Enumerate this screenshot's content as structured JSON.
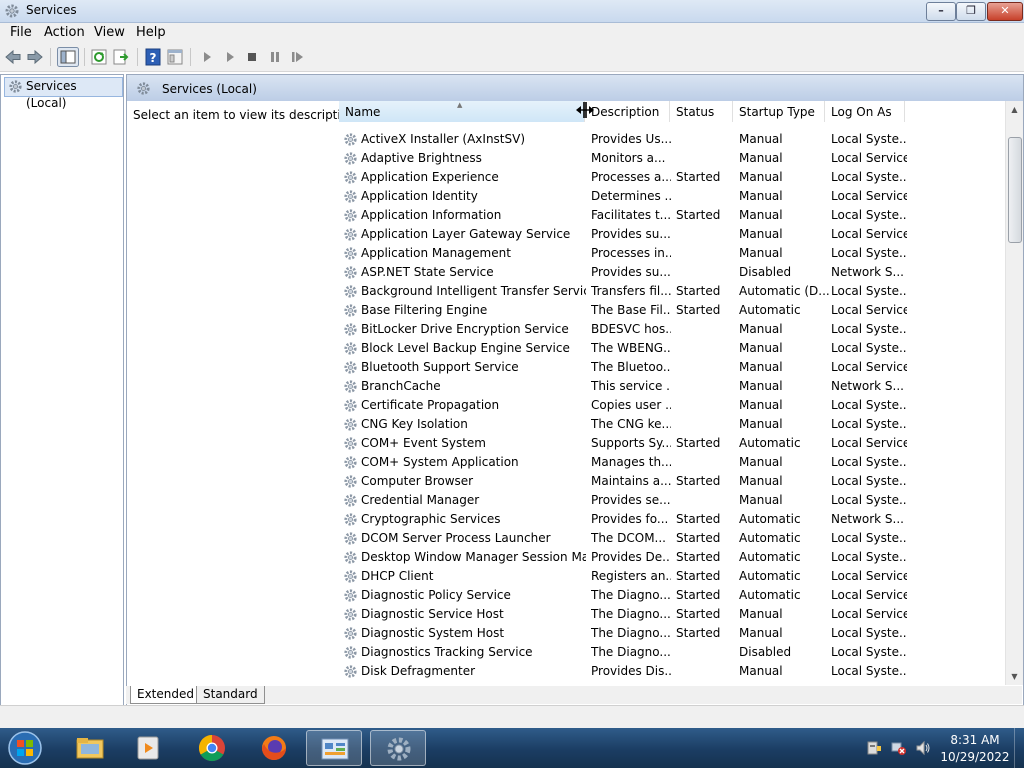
{
  "window": {
    "title": "Services"
  },
  "menu": [
    "File",
    "Action",
    "View",
    "Help"
  ],
  "tree": {
    "root": "Services (Local)"
  },
  "pane": {
    "title": "Services (Local)",
    "description_prompt": "Select an item to view its description."
  },
  "columns": [
    "Name",
    "Description",
    "Status",
    "Startup Type",
    "Log On As"
  ],
  "services": [
    [
      "ActiveX Installer (AxInstSV)",
      "Provides Us...",
      "",
      "Manual",
      "Local Syste..."
    ],
    [
      "Adaptive Brightness",
      "Monitors a...",
      "",
      "Manual",
      "Local Service"
    ],
    [
      "Application Experience",
      "Processes a...",
      "Started",
      "Manual",
      "Local Syste..."
    ],
    [
      "Application Identity",
      "Determines ...",
      "",
      "Manual",
      "Local Service"
    ],
    [
      "Application Information",
      "Facilitates t...",
      "Started",
      "Manual",
      "Local Syste..."
    ],
    [
      "Application Layer Gateway Service",
      "Provides su...",
      "",
      "Manual",
      "Local Service"
    ],
    [
      "Application Management",
      "Processes in...",
      "",
      "Manual",
      "Local Syste..."
    ],
    [
      "ASP.NET State Service",
      "Provides su...",
      "",
      "Disabled",
      "Network S..."
    ],
    [
      "Background Intelligent Transfer Service",
      "Transfers fil...",
      "Started",
      "Automatic (D...",
      "Local Syste..."
    ],
    [
      "Base Filtering Engine",
      "The Base Fil...",
      "Started",
      "Automatic",
      "Local Service"
    ],
    [
      "BitLocker Drive Encryption Service",
      "BDESVC hos...",
      "",
      "Manual",
      "Local Syste..."
    ],
    [
      "Block Level Backup Engine Service",
      "The WBENG...",
      "",
      "Manual",
      "Local Syste..."
    ],
    [
      "Bluetooth Support Service",
      "The Bluetoo...",
      "",
      "Manual",
      "Local Service"
    ],
    [
      "BranchCache",
      "This service ...",
      "",
      "Manual",
      "Network S..."
    ],
    [
      "Certificate Propagation",
      "Copies user ...",
      "",
      "Manual",
      "Local Syste..."
    ],
    [
      "CNG Key Isolation",
      "The CNG ke...",
      "",
      "Manual",
      "Local Syste..."
    ],
    [
      "COM+ Event System",
      "Supports Sy...",
      "Started",
      "Automatic",
      "Local Service"
    ],
    [
      "COM+ System Application",
      "Manages th...",
      "",
      "Manual",
      "Local Syste..."
    ],
    [
      "Computer Browser",
      "Maintains a...",
      "Started",
      "Manual",
      "Local Syste..."
    ],
    [
      "Credential Manager",
      "Provides se...",
      "",
      "Manual",
      "Local Syste..."
    ],
    [
      "Cryptographic Services",
      "Provides fo...",
      "Started",
      "Automatic",
      "Network S..."
    ],
    [
      "DCOM Server Process Launcher",
      "The DCOM...",
      "Started",
      "Automatic",
      "Local Syste..."
    ],
    [
      "Desktop Window Manager Session Man...",
      "Provides De...",
      "Started",
      "Automatic",
      "Local Syste..."
    ],
    [
      "DHCP Client",
      "Registers an...",
      "Started",
      "Automatic",
      "Local Service"
    ],
    [
      "Diagnostic Policy Service",
      "The Diagno...",
      "Started",
      "Automatic",
      "Local Service"
    ],
    [
      "Diagnostic Service Host",
      "The Diagno...",
      "Started",
      "Manual",
      "Local Service"
    ],
    [
      "Diagnostic System Host",
      "The Diagno...",
      "Started",
      "Manual",
      "Local Syste..."
    ],
    [
      "Diagnostics Tracking Service",
      "The Diagno...",
      "",
      "Disabled",
      "Local Syste..."
    ],
    [
      "Disk Defragmenter",
      "Provides Dis...",
      "",
      "Manual",
      "Local Syste..."
    ]
  ],
  "tabs": [
    "Extended",
    "Standard"
  ],
  "taskbar": {
    "time": "8:31 AM",
    "date": "10/29/2022"
  }
}
